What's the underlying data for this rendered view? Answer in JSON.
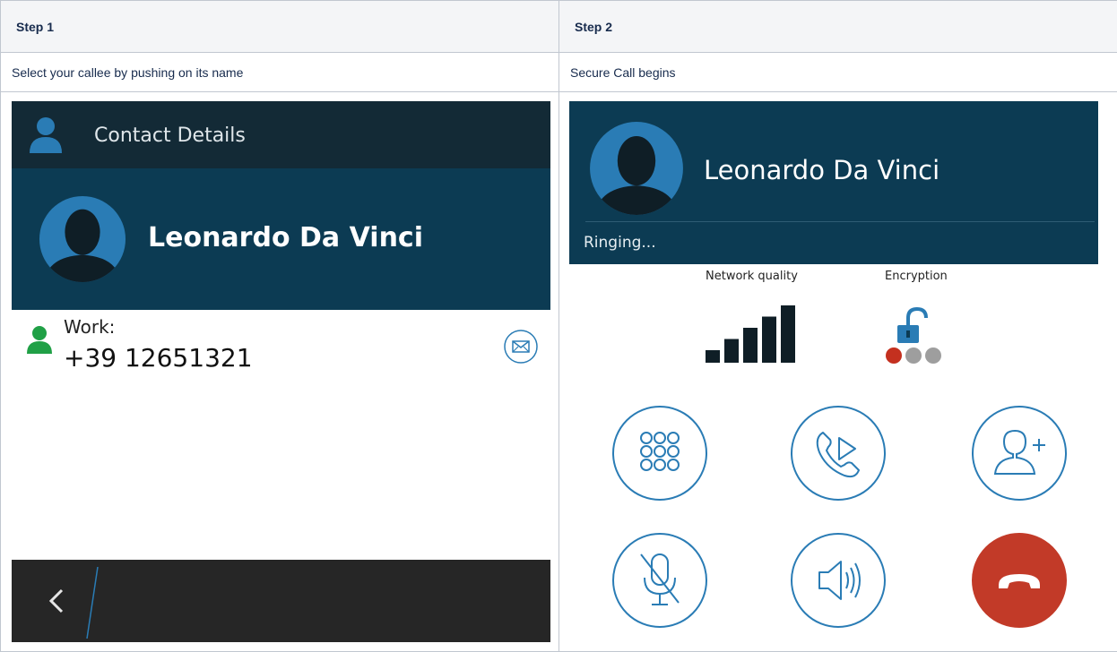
{
  "table": {
    "headers": [
      "Step 1",
      "Step 2"
    ],
    "descriptions": [
      "Select your callee by pushing on its name",
      "Secure Call begins"
    ]
  },
  "contact_screen": {
    "title": "Contact Details",
    "name": "Leonardo Da Vinci",
    "phone_label": "Work:",
    "phone_number": "+39 12651321"
  },
  "call_screen": {
    "name": "Leonardo Da Vinci",
    "status": "Ringing...",
    "network_quality_label": "Network quality",
    "encryption_label": "Encryption",
    "signal_level": 5,
    "signal_max": 5,
    "encryption_progress": 1,
    "encryption_steps": 3
  },
  "colors": {
    "header_bar": "#132a36",
    "banner": "#0c3b53",
    "accent_blue": "#2a7cb5",
    "end_call_red": "#c23a28",
    "encryption_active": "#c4301f",
    "encryption_inactive": "#9e9e9e",
    "contact_green": "#20a046"
  },
  "icons": [
    "person-icon",
    "avatar-icon",
    "message-icon",
    "back-chevron-icon",
    "signal-bars-icon",
    "unlocked-padlock-icon",
    "dialpad-icon",
    "call-transfer-icon",
    "add-participant-icon",
    "mute-microphone-icon",
    "speaker-icon",
    "end-call-icon"
  ]
}
